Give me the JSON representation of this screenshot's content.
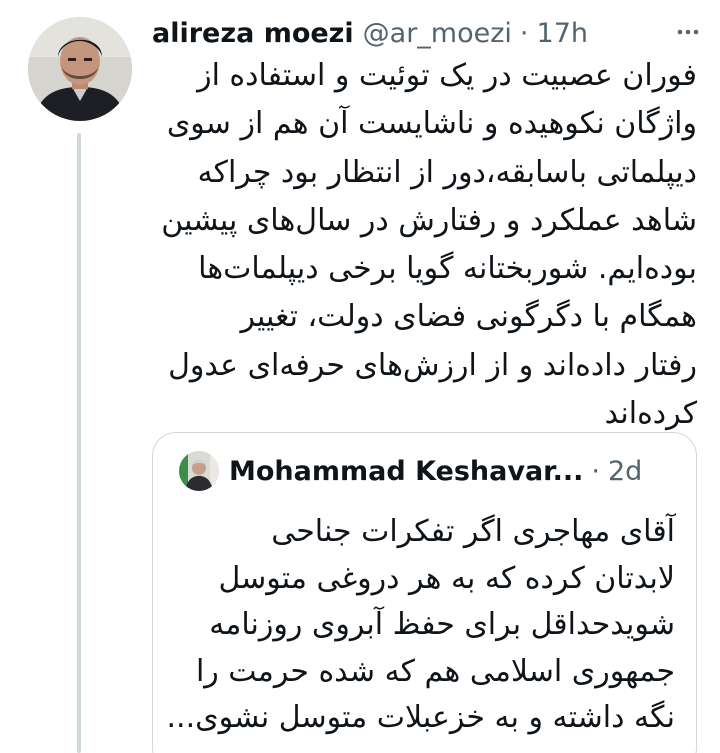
{
  "tweet": {
    "author_name": "alireza moezi",
    "author_handle": "@ar_moezi",
    "separator": "·",
    "timestamp": "17h",
    "more_icon": "more-dots-icon",
    "avatar_icon": "profile-photo",
    "text_lines": [
      "فوران عصبیت در یک توئیت و استفاده از",
      "واژگان نکوهیده و ناشایست آن هم از سوی",
      "دیپلماتی باسابقه،دور از انتظار بود چراکه",
      "شاهد عملکرد و رفتارش در سال‌های پیشین",
      "بوده‌ایم. شوربختانه گویا برخی دیپلمات‌ها",
      "همگام با دگرگونی فضای دولت، تغییر",
      "رفتار داده‌اند و از ارزش‌های حرفه‌ای عدول",
      "کرده‌اند"
    ]
  },
  "quote": {
    "author_name": "Mohammad Keshavar...",
    "separator": "·",
    "timestamp": "2d",
    "avatar_icon": "profile-photo",
    "text_lines": [
      "آقای مهاجری اگر تفکرات جناحی",
      "لابدتان کرده که به هر دروغی متوسل",
      "شویدحداقل برای حفظ آبروی روزنامه",
      "جمهوری اسلامی هم که شده حرمت را",
      "نگه داشته و به خزعبلات متوسل نشوی..."
    ]
  },
  "colors": {
    "text_primary": "#0f1419",
    "text_secondary": "#536471",
    "border": "#cfd9de",
    "background": "#ffffff"
  }
}
